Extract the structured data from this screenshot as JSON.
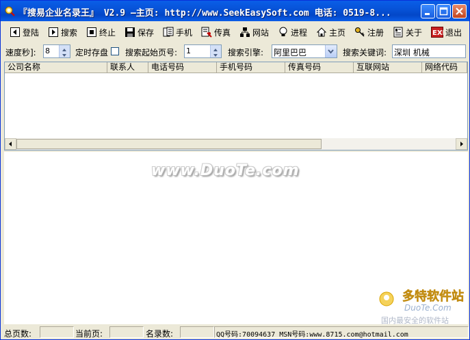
{
  "window": {
    "title": "『搜易企业名录王』 V2.9  —主页: http://www.SeekEasySoft.com 电话: 0519-8..."
  },
  "toolbar": {
    "login": "登陆",
    "search": "搜索",
    "stop": "终止",
    "save": "保存",
    "mobile": "手机",
    "fax": "传真",
    "website": "网站",
    "process": "进程",
    "homepage": "主页",
    "register": "注册",
    "about": "关于",
    "exit": "退出"
  },
  "options": {
    "speed_label": "速度秒]:",
    "speed_value": "8",
    "timed_save_label": "定时存盘",
    "timed_save_checked": false,
    "start_page_label": "搜索起始页号:",
    "start_page_value": "1",
    "engine_label": "搜索引擎:",
    "engine_value": "阿里巴巴",
    "keyword_label": "搜索关键词:",
    "keyword_value": "深圳 机械"
  },
  "grid": {
    "columns": [
      "公司名称",
      "联系人",
      "电话号码",
      "手机号码",
      "传真号码",
      "互联网站",
      "网络代码"
    ],
    "rows": []
  },
  "watermark": {
    "text": "www.DuoTe.com"
  },
  "logo": {
    "brand": "多特软件站",
    "domain": "DuoTe.Com",
    "slogan": "国内最安全的软件站"
  },
  "statusbar": {
    "total_pages_label": "总页数:",
    "total_pages_value": "",
    "current_page_label": "当前页:",
    "current_page_value": "",
    "records_label": "名录数:",
    "records_value": "",
    "contact_text": "QQ号码:70094637 MSN号码:www.8715.com@hotmail.com"
  },
  "colors": {
    "titlebar": "#0753d8",
    "face": "#ece9d8",
    "panel": "#ffffff"
  }
}
